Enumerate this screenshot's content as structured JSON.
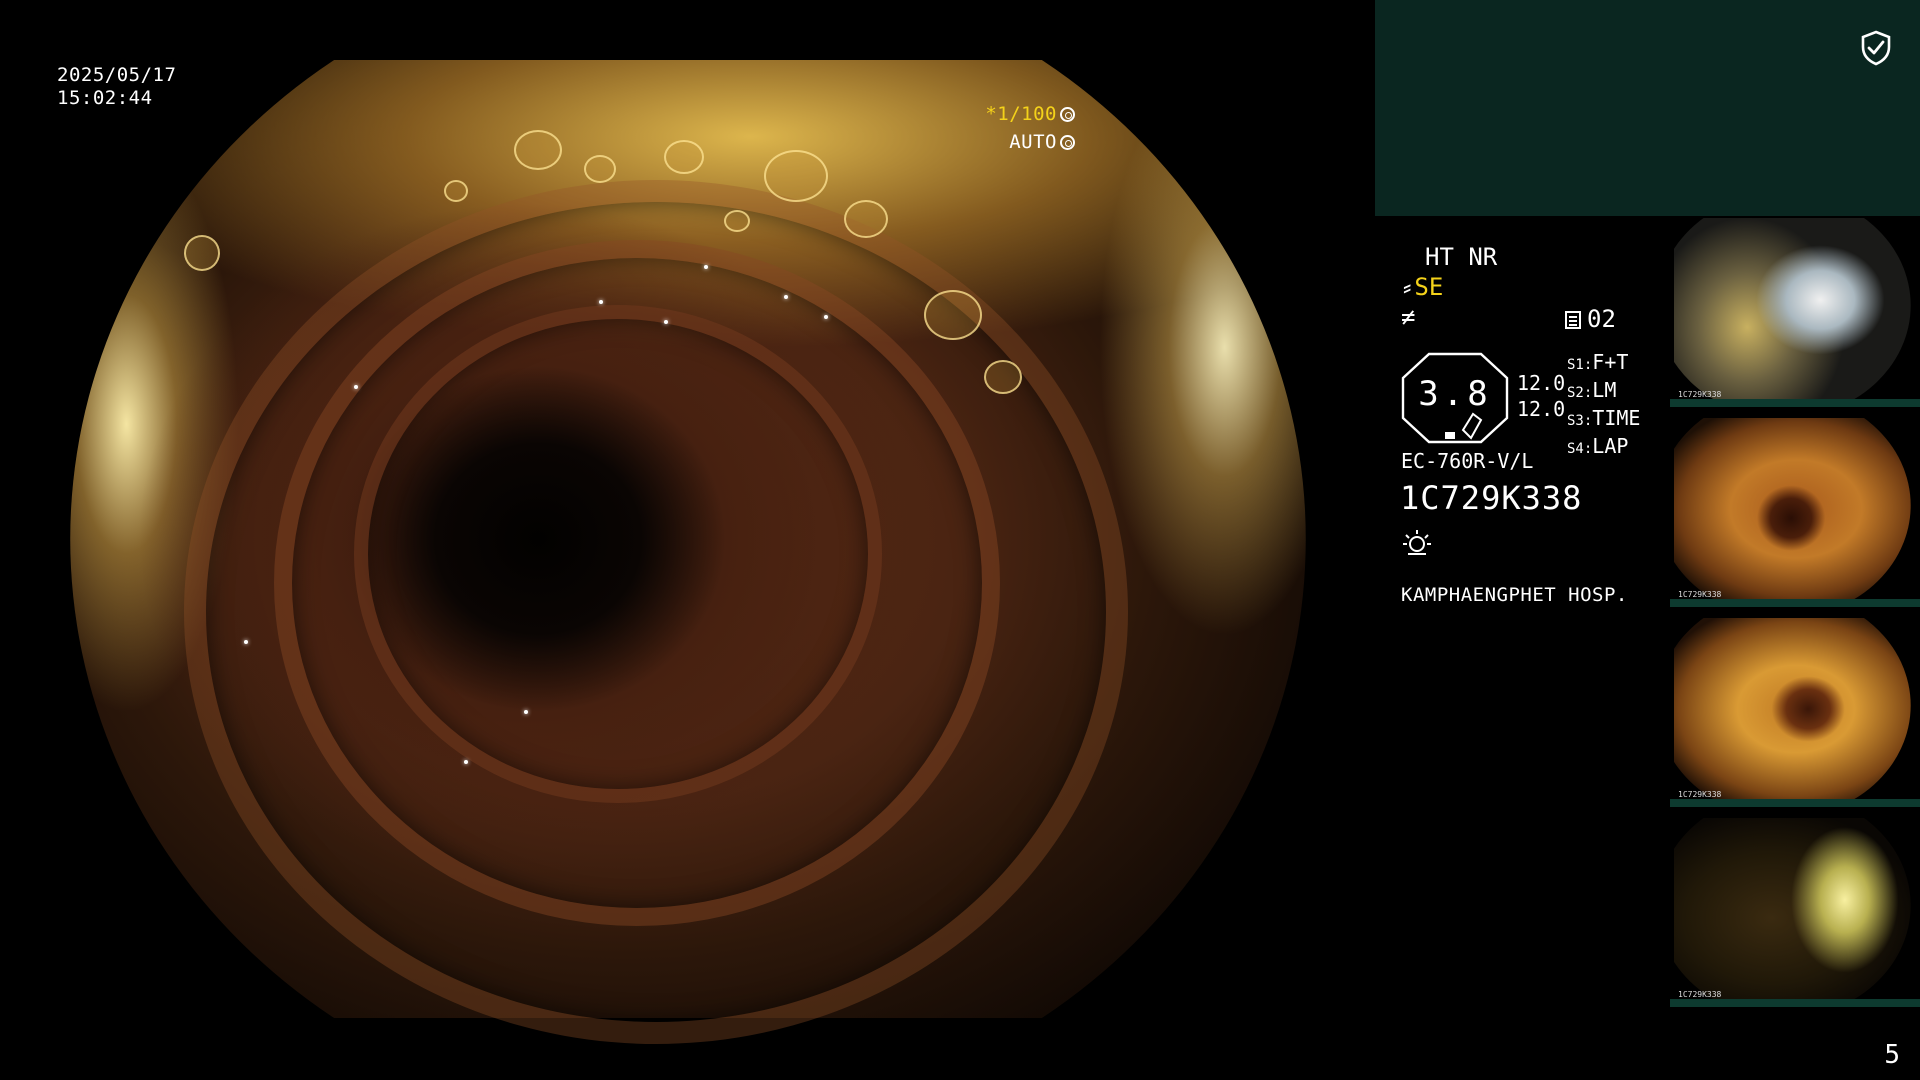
{
  "osd": {
    "date": "2025/05/17",
    "time": "15:02:44",
    "shutter_prefix": "*",
    "shutter_value": "1/100",
    "iris_mode": "AUTO"
  },
  "info": {
    "enhance_line1": "HT NR",
    "enhance_mode": "SE",
    "storage_count": "02",
    "octagon_value": "3.8",
    "dual_value_1": "12.0",
    "dual_value_2": "12.0",
    "switches": [
      {
        "key": "S1:",
        "value": "F+T"
      },
      {
        "key": "S2:",
        "value": "LM"
      },
      {
        "key": "S3:",
        "value": "TIME"
      },
      {
        "key": "S4:",
        "value": "LAP"
      }
    ],
    "scope_model": "EC-760R-V/L",
    "scope_serial": "1C729K338",
    "hospital": "KAMPHAENGPHET HOSP."
  },
  "thumbnails": [
    {
      "label": "1C729K338",
      "icon": "endoscopy-capture-thumbnail"
    },
    {
      "label": "1C729K338",
      "icon": "endoscopy-capture-thumbnail"
    },
    {
      "label": "1C729K338",
      "icon": "endoscopy-capture-thumbnail"
    },
    {
      "label": "1C729K338",
      "icon": "endoscopy-capture-thumbnail"
    }
  ],
  "page_number": "5",
  "colors": {
    "accent_yellow": "#f4d21a",
    "panel_green": "#0a2620",
    "background": "#000000"
  }
}
